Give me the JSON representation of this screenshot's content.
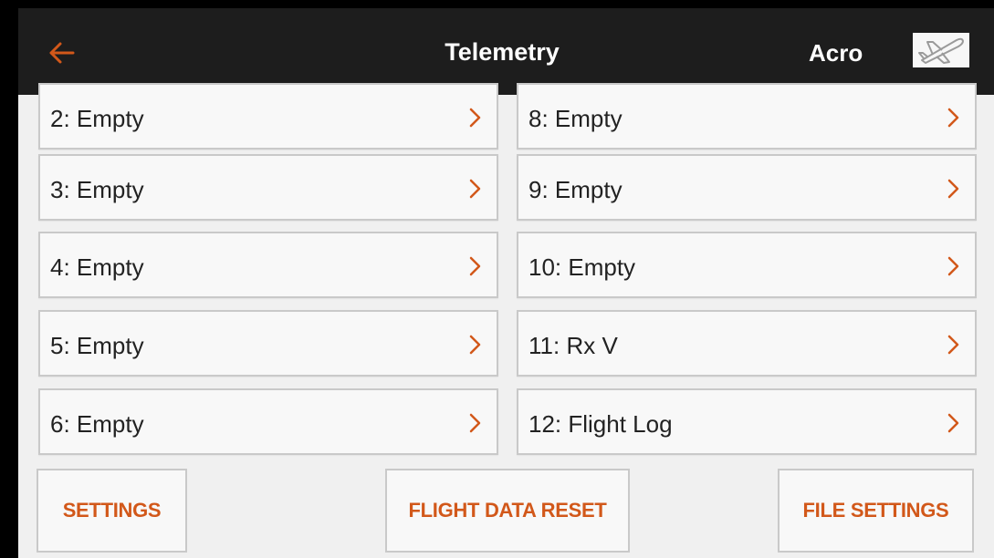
{
  "header": {
    "title": "Telemetry",
    "model_name": "Acro",
    "back_icon": "arrow-left-icon",
    "model_icon": "airplane-icon"
  },
  "slots": {
    "left": [
      {
        "label": "2: Empty"
      },
      {
        "label": "3: Empty"
      },
      {
        "label": "4: Empty"
      },
      {
        "label": "5: Empty"
      },
      {
        "label": "6: Empty"
      }
    ],
    "right": [
      {
        "label": "8: Empty"
      },
      {
        "label": "9: Empty"
      },
      {
        "label": "10: Empty"
      },
      {
        "label": "11: Rx V"
      },
      {
        "label": "12: Flight Log"
      }
    ],
    "chevron_icon": "chevron-right-icon"
  },
  "buttons": {
    "settings": "SETTINGS",
    "flight_data_reset": "FLIGHT DATA RESET",
    "file_settings": "FILE SETTINGS"
  },
  "colors": {
    "accent": "#d2581a",
    "header_bg": "#1d1d1d",
    "screen_bg": "#f0f0f0"
  }
}
